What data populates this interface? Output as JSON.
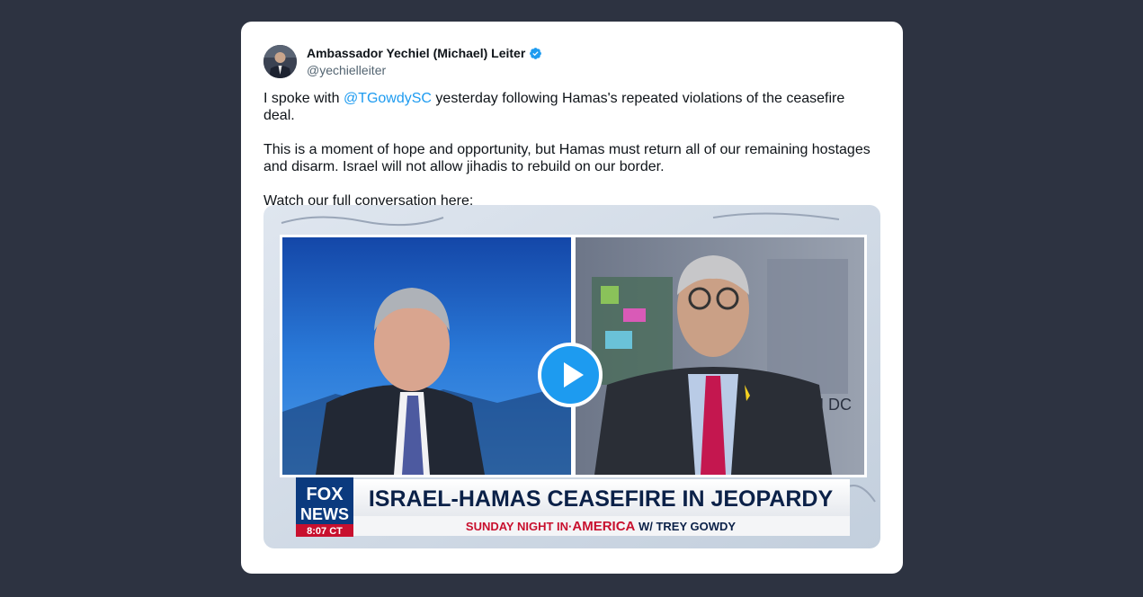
{
  "tweet": {
    "author_name": "Ambassador Yechiel (Michael) Leiter",
    "handle": "@yechielleiter",
    "text": {
      "p1_before": "I spoke with ",
      "p1_mention": "@TGowdySC",
      "p1_after": " yesterday following Hamas's repeated violations of the ceasefire deal.",
      "p2": "This is a moment of hope and opportunity, but Hamas must return all of our remaining hostages and disarm. Israel will not allow jihadis to rebuild on our border.",
      "p3": "Watch our full conversation here:"
    }
  },
  "video": {
    "network_logo_top": "FOX",
    "network_logo_bottom": "NEWS",
    "time": "8:07 CT",
    "headline": "ISRAEL-HAMAS CEASEFIRE IN JEOPARDY",
    "show_prefix": "SUNDAY NIGHT IN·",
    "show_highlight": "AMERICA",
    "show_suffix": " W/ TREY GOWDY",
    "backdrop_text": "N DC"
  },
  "colors": {
    "page_bg": "#2d3341",
    "link": "#1d9bf0",
    "verified": "#1d9bf0",
    "play": "#1d9bf0",
    "fox_blue": "#0b3a7e",
    "fox_red": "#c8102e"
  },
  "icons": {
    "verified": "verified-badge-icon",
    "play": "play-icon"
  }
}
